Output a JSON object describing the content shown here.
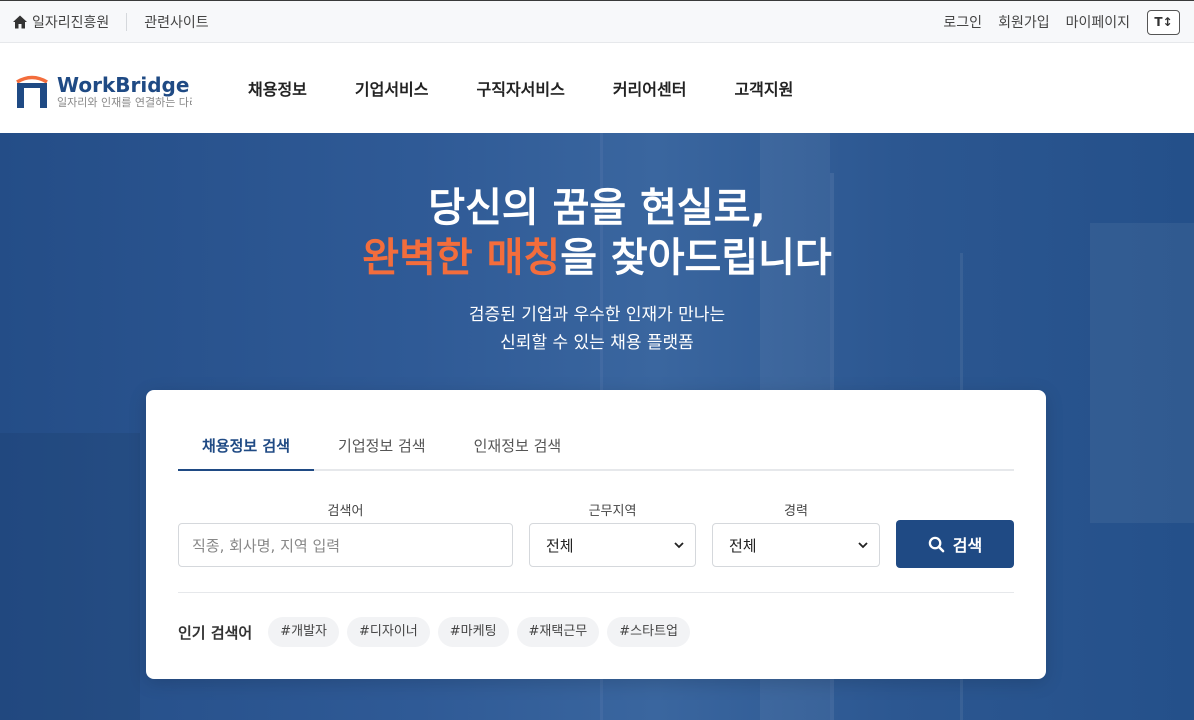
{
  "util": {
    "home_label": "일자리진흥원",
    "related_label": "관련사이트",
    "login": "로그인",
    "signup": "회원가입",
    "mypage": "마이페이지",
    "font_size_label": "T↕"
  },
  "logo": {
    "title": "WorkBridge",
    "subtitle": "일자리와 인재를 연결하는 다리"
  },
  "nav": [
    {
      "label": "채용정보"
    },
    {
      "label": "기업서비스"
    },
    {
      "label": "구직자서비스"
    },
    {
      "label": "커리어센터"
    },
    {
      "label": "고객지원"
    }
  ],
  "hero": {
    "title_line1": "당신의 꿈을 현실로,",
    "title_highlight": "완벽한 매칭",
    "title_line2_rest": "을 찾아드립니다",
    "sub_line1": "검증된 기업과 우수한 인재가 만나는",
    "sub_line2": "신뢰할 수 있는 채용 플랫폼"
  },
  "search": {
    "tabs": [
      {
        "label": "채용정보 검색",
        "active": true
      },
      {
        "label": "기업정보 검색",
        "active": false
      },
      {
        "label": "인재정보 검색",
        "active": false
      }
    ],
    "keyword_label": "검색어",
    "keyword_placeholder": "직종, 회사명, 지역 입력",
    "region_label": "근무지역",
    "region_value": "전체",
    "career_label": "경력",
    "career_value": "전체",
    "button_label": "검색",
    "popular_label": "인기 검색어",
    "popular_tags": [
      "#개발자",
      "#디자이너",
      "#마케팅",
      "#재택근무",
      "#스타트업"
    ]
  },
  "colors": {
    "brand": "#1f4a84",
    "accent": "#f36d3c"
  }
}
